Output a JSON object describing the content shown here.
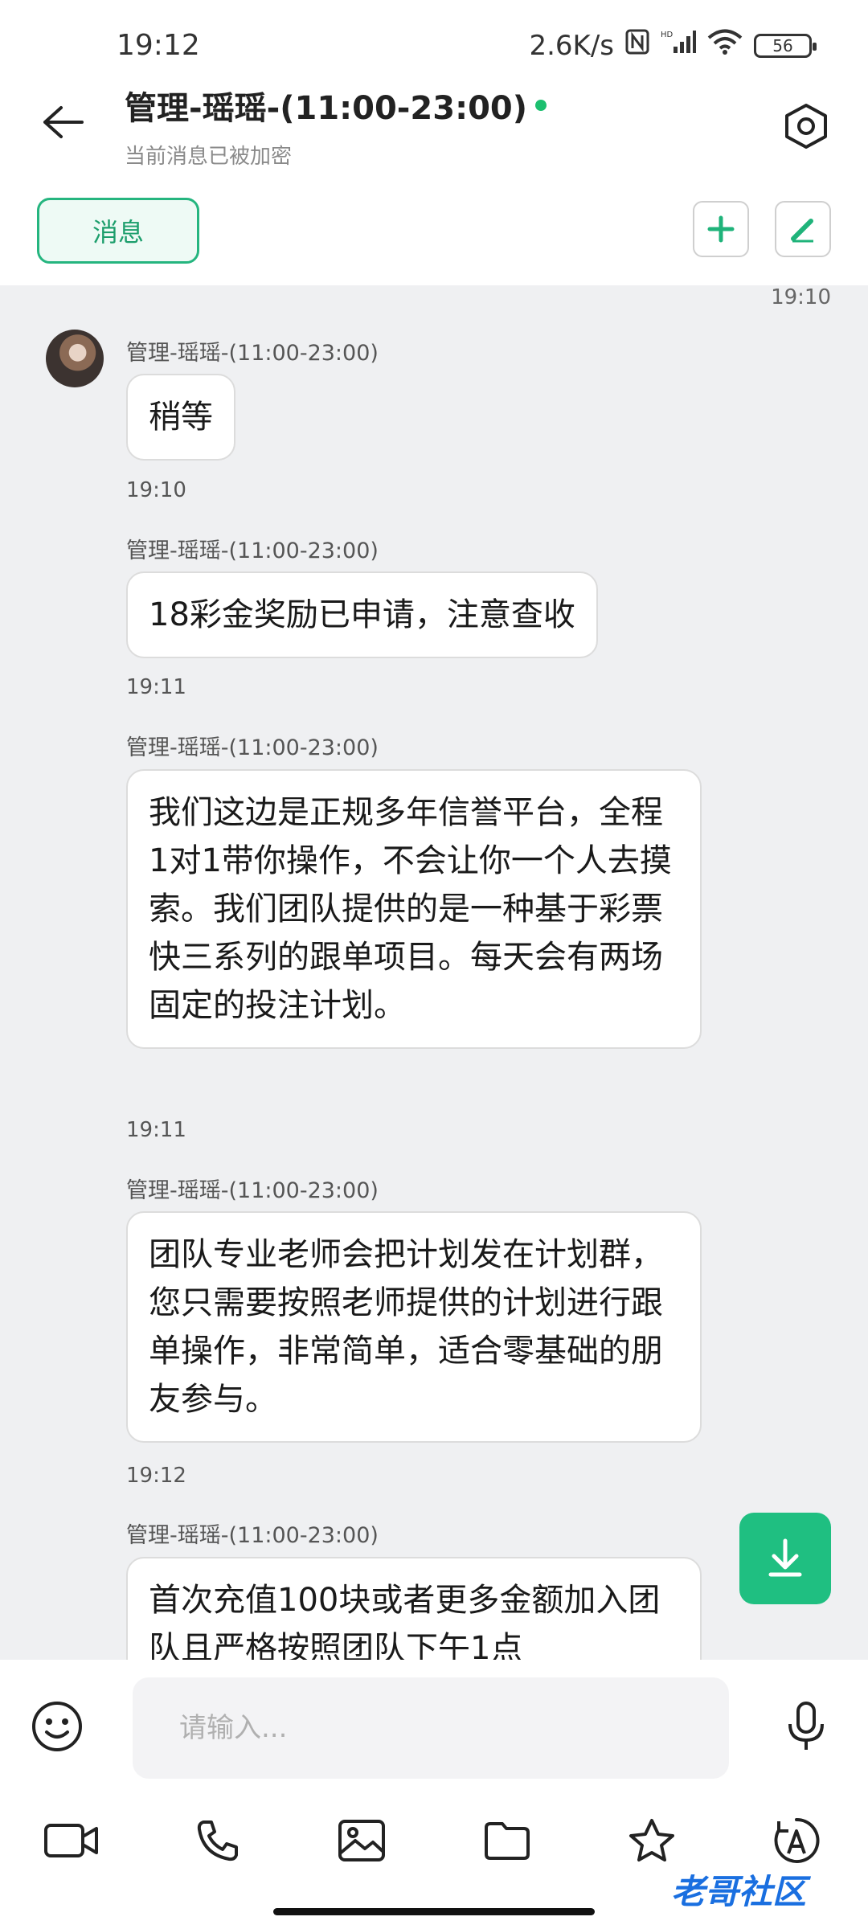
{
  "status_bar": {
    "time": "19:12",
    "net_speed": "2.6K/s",
    "battery": "56"
  },
  "header": {
    "title": "管理-瑶瑶-(11:00-23:00)",
    "subtitle": "当前消息已被加密",
    "online_color": "#1cbf6f"
  },
  "toolbar": {
    "tab_label": "消息"
  },
  "chat": {
    "top_time": "19:10",
    "messages": [
      {
        "sender": "管理-瑶瑶-(11:00-23:00)",
        "text": "稍等",
        "time": "19:10"
      },
      {
        "sender": "管理-瑶瑶-(11:00-23:00)",
        "text": "18彩金奖励已申请，注意查收",
        "time": "19:11"
      },
      {
        "sender": "管理-瑶瑶-(11:00-23:00)",
        "text": "我们这边是正规多年信誉平台，全程1对1带你操作，不会让你一个人去摸索。我们团队提供的是一种基于彩票快三系列的跟单项目。每天会有两场固定的投注计划。",
        "time": "19:11"
      },
      {
        "sender": "管理-瑶瑶-(11:00-23:00)",
        "text": "团队专业老师会把计划发在计划群，您只需要按照老师提供的计划进行跟单操作，非常简单，适合零基础的朋友参与。",
        "time": "19:12"
      },
      {
        "sender": "管理-瑶瑶-(11:00-23:00)",
        "text": "首次充值100块或者更多金额加入团队且严格按照团队下午1点"
      }
    ]
  },
  "input": {
    "placeholder": "请输入..."
  },
  "watermark": "老哥社区",
  "colors": {
    "accent": "#1fbf81",
    "chat_bg": "#eff0f2"
  }
}
